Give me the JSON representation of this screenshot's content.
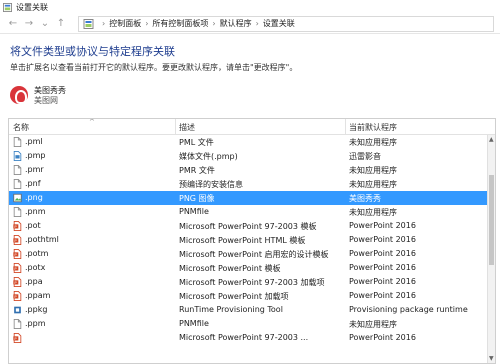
{
  "window": {
    "title": "设置关联"
  },
  "breadcrumb": [
    "控制面板",
    "所有控制面板项",
    "默认程序",
    "设置关联"
  ],
  "heading": "将文件类型或协议与特定程序关联",
  "subtext": "单击扩展名以查看当前打开它的默认程序。要更改默认程序，请单击\"更改程序\"。",
  "program": {
    "name": "美图秀秀",
    "company": "美图网"
  },
  "table": {
    "headers": [
      "名称",
      "描述",
      "当前默认程序"
    ],
    "rows": [
      {
        "name": ".pml",
        "desc": "PML 文件",
        "prog": "未知应用程序",
        "icon": "generic",
        "selected": false
      },
      {
        "name": ".pmp",
        "desc": "媒体文件(.pmp)",
        "prog": "迅雷影音",
        "icon": "media",
        "selected": false
      },
      {
        "name": ".pmr",
        "desc": "PMR 文件",
        "prog": "未知应用程序",
        "icon": "generic",
        "selected": false
      },
      {
        "name": ".pnf",
        "desc": "预编译的安装信息",
        "prog": "未知应用程序",
        "icon": "generic",
        "selected": false
      },
      {
        "name": ".png",
        "desc": "PNG 图像",
        "prog": "美图秀秀",
        "icon": "image",
        "selected": true
      },
      {
        "name": ".pnm",
        "desc": "PNMfile",
        "prog": "未知应用程序",
        "icon": "generic",
        "selected": false
      },
      {
        "name": ".pot",
        "desc": "Microsoft PowerPoint 97-2003 模板",
        "prog": "PowerPoint 2016",
        "icon": "ppt",
        "selected": false
      },
      {
        "name": ".pothtml",
        "desc": "Microsoft PowerPoint HTML 模板",
        "prog": "PowerPoint 2016",
        "icon": "ppt",
        "selected": false
      },
      {
        "name": ".potm",
        "desc": "Microsoft PowerPoint 启用宏的设计模板",
        "prog": "PowerPoint 2016",
        "icon": "ppt",
        "selected": false
      },
      {
        "name": ".potx",
        "desc": "Microsoft PowerPoint 模板",
        "prog": "PowerPoint 2016",
        "icon": "ppt",
        "selected": false
      },
      {
        "name": ".ppa",
        "desc": "Microsoft PowerPoint 97-2003 加载项",
        "prog": "PowerPoint 2016",
        "icon": "ppt",
        "selected": false
      },
      {
        "name": ".ppam",
        "desc": "Microsoft PowerPoint 加载项",
        "prog": "PowerPoint 2016",
        "icon": "ppt",
        "selected": false
      },
      {
        "name": ".ppkg",
        "desc": "RunTime Provisioning Tool",
        "prog": "Provisioning package runtime",
        "icon": "pkg",
        "selected": false
      },
      {
        "name": ".ppm",
        "desc": "PNMfile",
        "prog": "未知应用程序",
        "icon": "generic",
        "selected": false
      },
      {
        "name": "",
        "desc": "Microsoft PowerPoint 97-2003 ...",
        "prog": "PowerPoint 2016",
        "icon": "ppt",
        "selected": false
      }
    ]
  },
  "colors": {
    "accent": "#3399ff",
    "heading": "#1e3d8f",
    "ppt": "#d24726"
  }
}
